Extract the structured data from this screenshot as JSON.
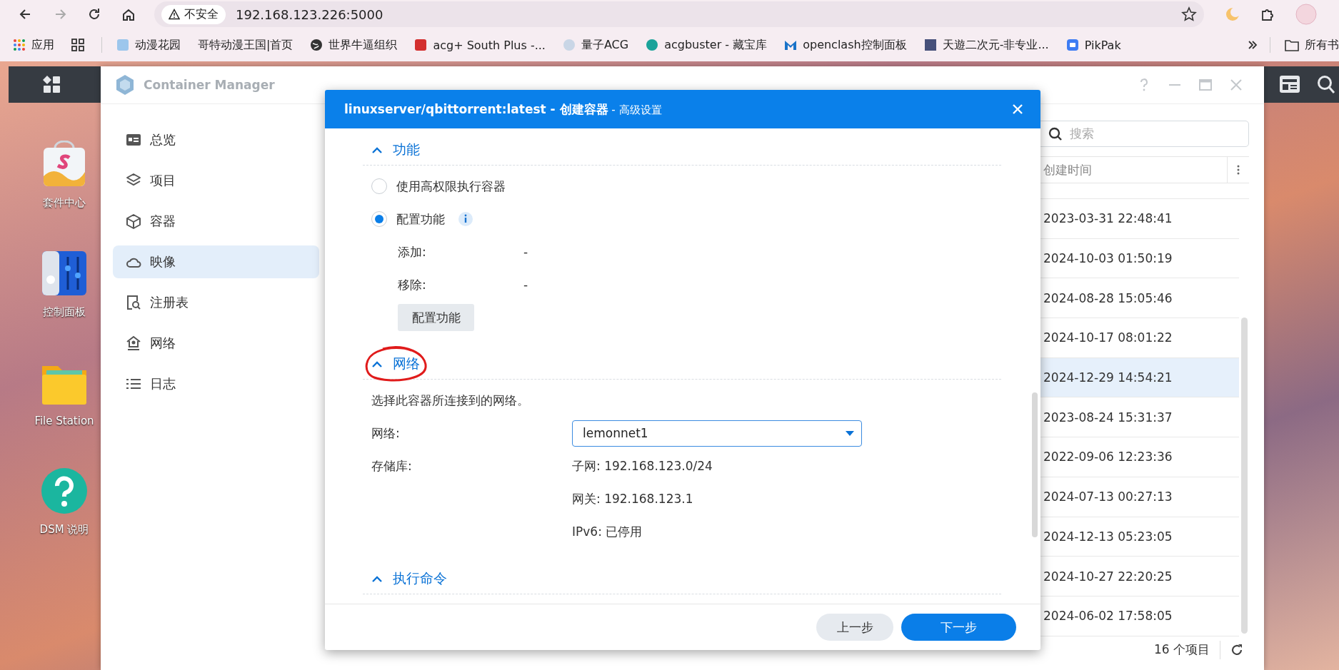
{
  "browser": {
    "security_label": "不安全",
    "url": "192.168.123.226:5000"
  },
  "bookmarks": [
    {
      "label": "应用"
    },
    {
      "label": "动漫花园"
    },
    {
      "label": "哥特动漫王国|首页"
    },
    {
      "label": "世界牛逼组织"
    },
    {
      "label": "acg+ South Plus -..."
    },
    {
      "label": "量子ACG"
    },
    {
      "label": "acgbuster - 藏宝库"
    },
    {
      "label": "openclash控制面板"
    },
    {
      "label": "天遊二次元-非专业..."
    },
    {
      "label": "PikPak"
    }
  ],
  "other_bookmarks": "所有书",
  "desktop_icons": [
    {
      "label": "套件中心"
    },
    {
      "label": "控制面板"
    },
    {
      "label": "File Station"
    },
    {
      "label": "DSM 说明"
    }
  ],
  "window": {
    "title": "Container Manager",
    "sidebar": {
      "items": [
        {
          "label": "总览",
          "selected": false
        },
        {
          "label": "项目",
          "selected": false
        },
        {
          "label": "容器",
          "selected": false
        },
        {
          "label": "映像",
          "selected": true
        },
        {
          "label": "注册表",
          "selected": false
        },
        {
          "label": "网络",
          "selected": false
        },
        {
          "label": "日志",
          "selected": false
        }
      ]
    },
    "search": {
      "placeholder": "搜索"
    },
    "table": {
      "columns": [
        "创建时间"
      ],
      "rows": [
        {
          "created": "2023-03-31 22:48:41",
          "selected": false
        },
        {
          "created": "2024-10-03 01:50:19",
          "selected": false
        },
        {
          "created": "2024-08-28 15:05:46",
          "selected": false
        },
        {
          "created": "2024-10-17 08:01:22",
          "selected": false
        },
        {
          "created": "2024-12-29 14:54:21",
          "selected": true
        },
        {
          "created": "2023-08-24 15:31:37",
          "selected": false
        },
        {
          "created": "2022-09-06 12:23:36",
          "selected": false
        },
        {
          "created": "2024-07-13 00:27:13",
          "selected": false
        },
        {
          "created": "2024-12-13 05:23:05",
          "selected": false
        },
        {
          "created": "2024-10-27 22:20:25",
          "selected": false
        },
        {
          "created": "2024-06-02 17:58:05",
          "selected": false
        }
      ]
    },
    "footer": {
      "count": "16 个项目"
    }
  },
  "dialog": {
    "title": "**linuxserver/qbittorrent:latest - 创建容器** - 高级设置",
    "sections": [
      {
        "kind": "capabilities",
        "title": "功能",
        "expanded": true,
        "options": [
          {
            "label": "使用高权限执行容器",
            "selected": false,
            "info": false
          },
          {
            "label": "配置功能",
            "selected": true,
            "info": true
          }
        ],
        "fields": [
          {
            "label": "添加:",
            "value": "-"
          },
          {
            "label": "移除:",
            "value": "-"
          }
        ],
        "button": "配置功能"
      },
      {
        "kind": "network",
        "title": "网络",
        "expanded": true,
        "description": "选择此容器所连接到的网络。",
        "network_label": "网络:",
        "network_value": "lemonnet1",
        "repository_label": "存储库:",
        "details": [
          "子网: 192.168.123.0/24",
          "网关: 192.168.123.1",
          "IPv6: 已停用"
        ]
      },
      {
        "kind": "command",
        "title": "执行命令",
        "expanded": true
      }
    ],
    "buttons": [
      {
        "label": "上一步",
        "kind": "secondary"
      },
      {
        "label": "下一步",
        "kind": "primary"
      }
    ]
  }
}
